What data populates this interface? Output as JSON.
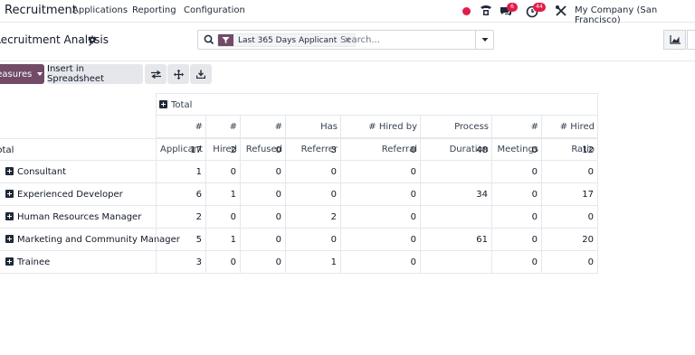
{
  "navbar": {
    "app_title": "Recruitment",
    "menus": [
      "Applications",
      "Reporting",
      "Configuration"
    ],
    "chat_badge": "6",
    "activity_badge": "44",
    "company": "My Company (San Francisco)",
    "status_dot_color": "#e11d48"
  },
  "control_panel": {
    "title": "Recruitment Analysis",
    "facet_label": "Last 365 Days Applicant",
    "facet_remove": "×",
    "search_placeholder": "Search..."
  },
  "buttons": {
    "measures": "Measures",
    "insert": "Insert in Spreadsheet"
  },
  "pivot": {
    "column_group": "Total",
    "measures": [
      "# Applicant",
      "# Hired",
      "# Refused",
      "Has Referrer",
      "# Hired by Referral",
      "Process Duration",
      "# Meetings",
      "# Hired Ratio"
    ],
    "rows": [
      {
        "label": "Total",
        "expandable": false,
        "values": [
          "17",
          "2",
          "0",
          "3",
          "0",
          "48",
          "0",
          "12"
        ]
      },
      {
        "label": "Consultant",
        "expandable": true,
        "values": [
          "1",
          "0",
          "0",
          "0",
          "0",
          "",
          "0",
          "0"
        ]
      },
      {
        "label": "Experienced Developer",
        "expandable": true,
        "values": [
          "6",
          "1",
          "0",
          "0",
          "0",
          "34",
          "0",
          "17"
        ]
      },
      {
        "label": "Human Resources Manager",
        "expandable": true,
        "values": [
          "2",
          "0",
          "0",
          "2",
          "0",
          "",
          "0",
          "0"
        ]
      },
      {
        "label": "Marketing and Community Manager",
        "expandable": true,
        "values": [
          "5",
          "1",
          "0",
          "0",
          "0",
          "61",
          "0",
          "20"
        ]
      },
      {
        "label": "Trainee",
        "expandable": true,
        "values": [
          "3",
          "0",
          "0",
          "1",
          "0",
          "",
          "0",
          "0"
        ]
      }
    ]
  },
  "colors": {
    "primary": "#714b67",
    "badge": "#e11d48"
  }
}
